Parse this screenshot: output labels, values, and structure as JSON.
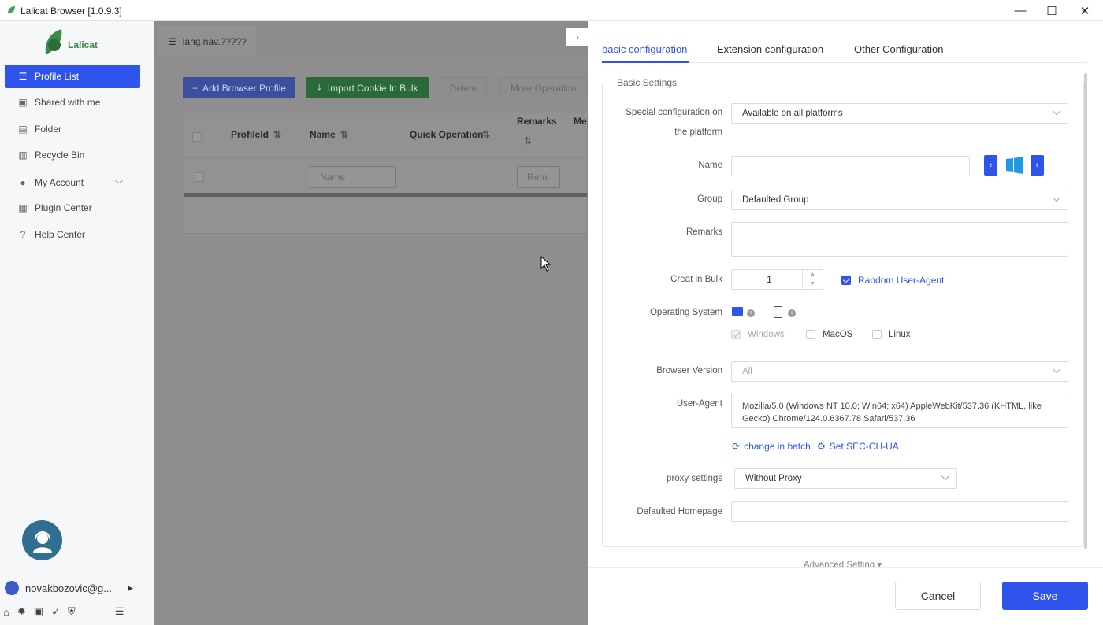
{
  "window": {
    "title": "Lalicat Browser  [1.0.9.3]",
    "minimize": "—",
    "maximize": "☐",
    "close": "✕"
  },
  "sidebar": {
    "logo_text": "Lalicat",
    "items": [
      {
        "label": "Profile List",
        "icon": "list-icon"
      },
      {
        "label": "Shared with me",
        "icon": "share-icon"
      },
      {
        "label": "Folder",
        "icon": "folder-icon"
      },
      {
        "label": "Recycle Bin",
        "icon": "recycle-icon"
      },
      {
        "label": "My Account",
        "icon": "account-icon"
      },
      {
        "label": "Plugin Center",
        "icon": "plugin-icon"
      },
      {
        "label": "Help Center",
        "icon": "help-icon"
      }
    ],
    "user_email": "novakbozovic@g...",
    "bottom_icons": [
      "home-icon",
      "theme-icon",
      "linkedin-icon",
      "rocket-icon",
      "shield-icon",
      "collapse-icon"
    ]
  },
  "main": {
    "page_tab": "lang.nav.?????",
    "toolbar": {
      "add_profile": "Add Browser Profile",
      "import_cookie": "Import Cookie In Bulk",
      "delete": "Delete",
      "more": "More Operation"
    },
    "table": {
      "columns": [
        "ProfileId",
        "Name",
        "Quick Operation",
        "Remarks",
        "Me"
      ],
      "name_filter_placeholder": "Name",
      "remarks_filter_placeholder": "Remi"
    }
  },
  "panel": {
    "tabs": [
      "basic configuration",
      "Extension configuration",
      "Other Configuration"
    ],
    "section_title": "Basic Settings",
    "fields": {
      "special_config_label_1": "Special configuration on",
      "special_config_label_2": "the platform",
      "special_config_value": "Available on all platforms",
      "name_label": "Name",
      "name_value": "",
      "group_label": "Group",
      "group_value": "Defaulted Group",
      "remarks_label": "Remarks",
      "bulk_label": "Creat in Bulk",
      "bulk_value": "1",
      "random_ua_label": "Random User-Agent",
      "os_label": "Operating System",
      "os_windows": "Windows",
      "os_macos": "MacOS",
      "os_linux": "Linux",
      "browser_version_label": "Browser Version",
      "browser_version_value": "All",
      "ua_label": "User-Agent",
      "ua_value": "Mozilla/5.0 (Windows NT 10.0; Win64; x64) AppleWebKit/537.36 (KHTML, like Gecko) Chrome/124.0.6367.78 Safari/537.36",
      "change_batch": "change in batch",
      "set_sec": "Set SEC-CH-UA",
      "proxy_label": "proxy settings",
      "proxy_value": "Without Proxy",
      "homepage_label": "Defaulted Homepage",
      "homepage_value": ""
    },
    "advanced": "Advanced Setting",
    "cancel": "Cancel",
    "save": "Save"
  },
  "colors": {
    "accent": "#2f54eb",
    "green": "#24a148",
    "windows_blue": "#1e9bde"
  }
}
